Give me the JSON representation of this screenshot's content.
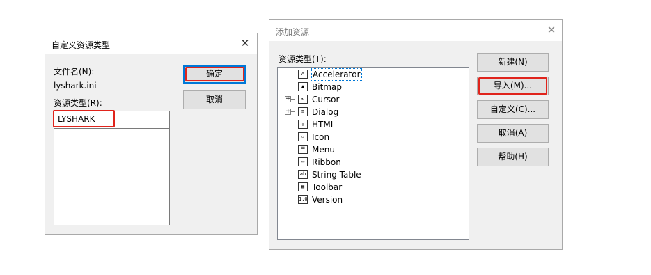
{
  "dialog1": {
    "title": "自定义资源类型",
    "file_label": "文件名(N):",
    "file_value": "lyshark.ini",
    "type_label": "资源类型(R):",
    "type_value": "LYSHARK",
    "ok_label": "确定",
    "cancel_label": "取消"
  },
  "dialog2": {
    "title": "添加资源",
    "tree_label": "资源类型(T):",
    "tree_items": [
      {
        "label": "Accelerator",
        "icon": "accelerator-icon",
        "expandable": false
      },
      {
        "label": "Bitmap",
        "icon": "bitmap-icon",
        "expandable": false
      },
      {
        "label": "Cursor",
        "icon": "cursor-icon",
        "expandable": true
      },
      {
        "label": "Dialog",
        "icon": "dialog-icon",
        "expandable": true
      },
      {
        "label": "HTML",
        "icon": "html-icon",
        "expandable": false
      },
      {
        "label": "Icon",
        "icon": "icon-resource-icon",
        "expandable": false
      },
      {
        "label": "Menu",
        "icon": "menu-icon",
        "expandable": false
      },
      {
        "label": "Ribbon",
        "icon": "ribbon-icon",
        "expandable": false
      },
      {
        "label": "String Table",
        "icon": "string-table-icon",
        "expandable": false
      },
      {
        "label": "Toolbar",
        "icon": "toolbar-icon",
        "expandable": false
      },
      {
        "label": "Version",
        "icon": "version-icon",
        "expandable": false
      }
    ],
    "buttons": {
      "new": "新建(N)",
      "import": "导入(M)...",
      "custom": "自定义(C)...",
      "cancel": "取消(A)",
      "help": "帮助(H)"
    }
  },
  "highlight_color": "#e0241c"
}
